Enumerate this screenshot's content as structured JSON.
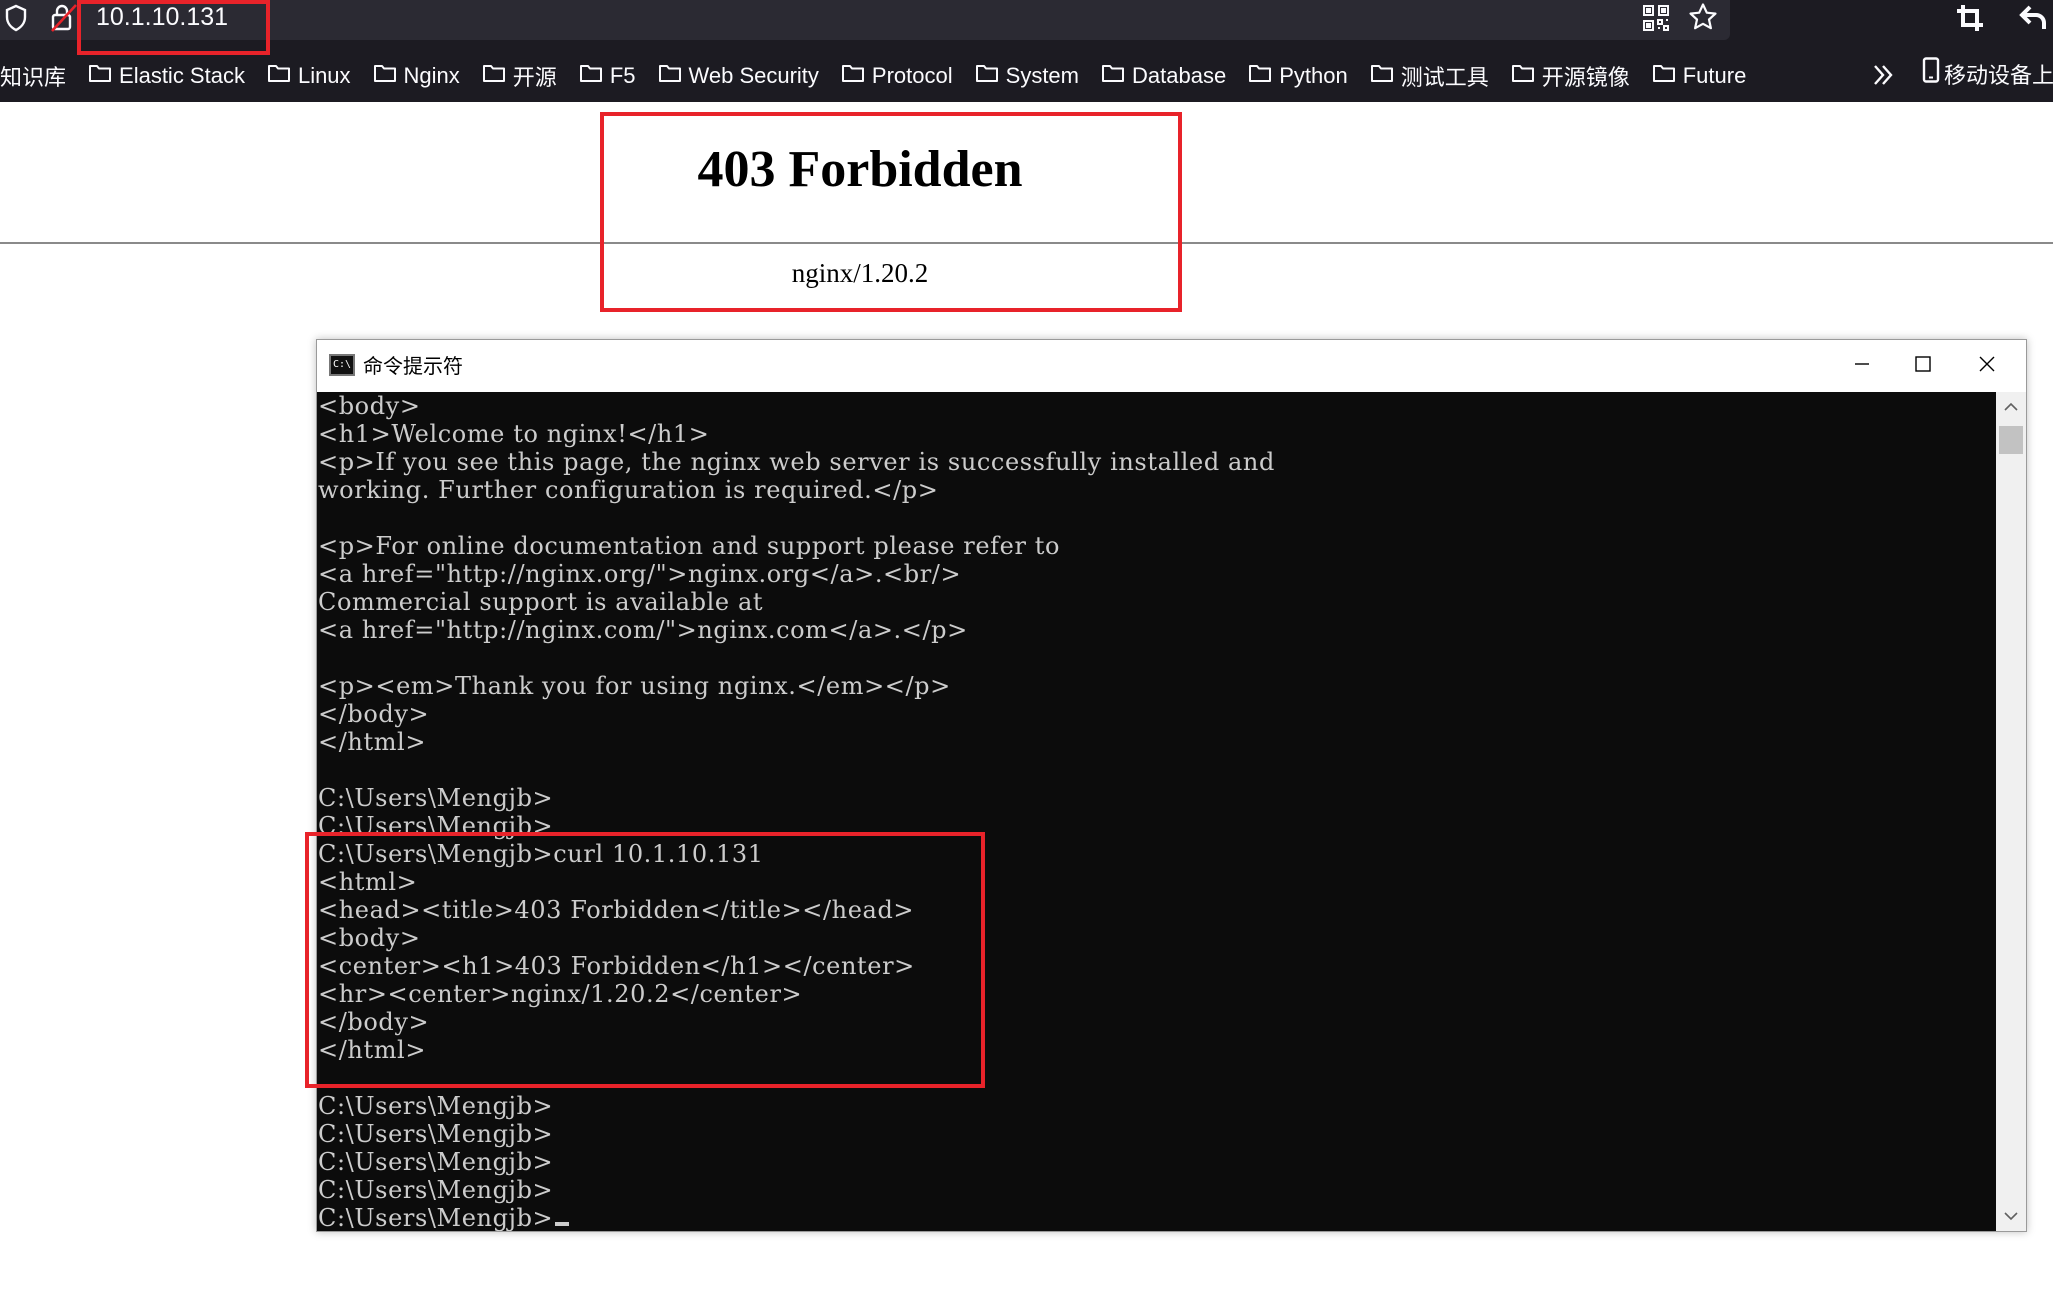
{
  "browser": {
    "url": "10.1.10.131",
    "bookmarks": [
      {
        "label": "知识库",
        "folder": false
      },
      {
        "label": "Elastic Stack",
        "folder": true
      },
      {
        "label": "Linux",
        "folder": true
      },
      {
        "label": "Nginx",
        "folder": true
      },
      {
        "label": "开源",
        "folder": true
      },
      {
        "label": "F5",
        "folder": true
      },
      {
        "label": "Web Security",
        "folder": true
      },
      {
        "label": "Protocol",
        "folder": true
      },
      {
        "label": "System",
        "folder": true
      },
      {
        "label": "Database",
        "folder": true
      },
      {
        "label": "Python",
        "folder": true
      },
      {
        "label": "测试工具",
        "folder": true
      },
      {
        "label": "开源镜像",
        "folder": true
      },
      {
        "label": "Future",
        "folder": true
      }
    ],
    "mobile_bookmarks": "移动设备上",
    "icons": [
      "shield-icon",
      "lock-warning-icon",
      "qr-code-icon",
      "star-icon",
      "crop-icon",
      "back-icon",
      "folder-icon",
      "chevrons-right-icon",
      "phone-icon"
    ],
    "colors": {
      "chrome_bg": "#1c1b22",
      "urlbar_bg": "#2b2a33",
      "annotation_red": "#e8232a"
    }
  },
  "page": {
    "heading": "403 Forbidden",
    "server": "nginx/1.20.2"
  },
  "cmd": {
    "title": "命令提示符",
    "icon_text": "C:\\",
    "lines": [
      "<body>",
      "<h1>Welcome to nginx!</h1>",
      "<p>If you see this page, the nginx web server is successfully installed and",
      "working. Further configuration is required.</p>",
      "",
      "<p>For online documentation and support please refer to",
      "<a href=\"http://nginx.org/\">nginx.org</a>.<br/>",
      "Commercial support is available at",
      "<a href=\"http://nginx.com/\">nginx.com</a>.</p>",
      "",
      "<p><em>Thank you for using nginx.</em></p>",
      "</body>",
      "</html>",
      "",
      "C:\\Users\\Mengjb>",
      "C:\\Users\\Mengjb>",
      "C:\\Users\\Mengjb>curl 10.1.10.131",
      "<html>",
      "<head><title>403 Forbidden</title></head>",
      "<body>",
      "<center><h1>403 Forbidden</h1></center>",
      "<hr><center>nginx/1.20.2</center>",
      "</body>",
      "</html>",
      "",
      "C:\\Users\\Mengjb>",
      "C:\\Users\\Mengjb>",
      "C:\\Users\\Mengjb>",
      "C:\\Users\\Mengjb>",
      "C:\\Users\\Mengjb>"
    ],
    "colors": {
      "console_bg": "#0c0c0c",
      "console_fg": "#cccccc"
    }
  }
}
